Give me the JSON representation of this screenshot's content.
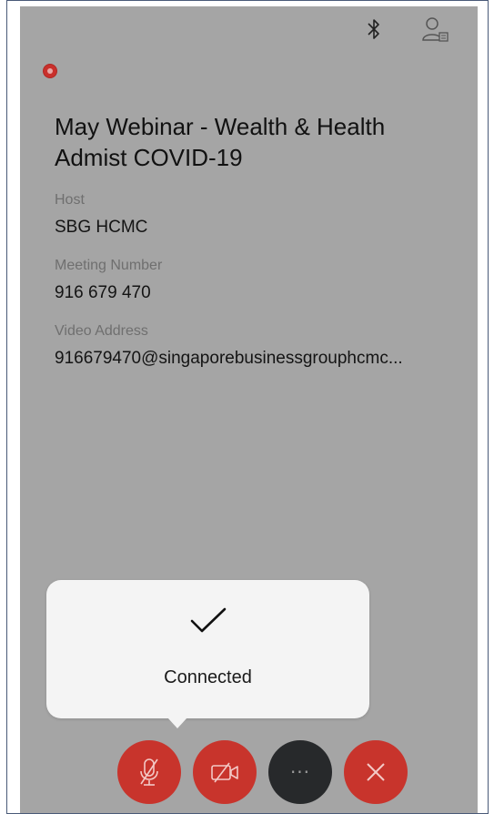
{
  "status_bar": {
    "bluetooth_icon": "bluetooth-icon",
    "contact_icon": "contact-card-icon"
  },
  "meeting": {
    "recording_indicator_color": "#c9302c",
    "title": "May Webinar - Wealth & Health Admist COVID-19",
    "host_label": "Host",
    "host_value": "SBG HCMC",
    "number_label": "Meeting Number",
    "number_value": "916 679 470",
    "video_label": "Video Address",
    "video_value": "916679470@singaporebusinessgrouphcmc..."
  },
  "toast": {
    "icon": "checkmark-icon",
    "text": "Connected"
  },
  "controls": {
    "mute_icon": "microphone-muted-icon",
    "video_icon": "video-off-icon",
    "more_icon": "more-icon",
    "more_label": "···",
    "end_icon": "close-icon",
    "accent_color": "#c8342c",
    "dark_color": "#27292b"
  }
}
